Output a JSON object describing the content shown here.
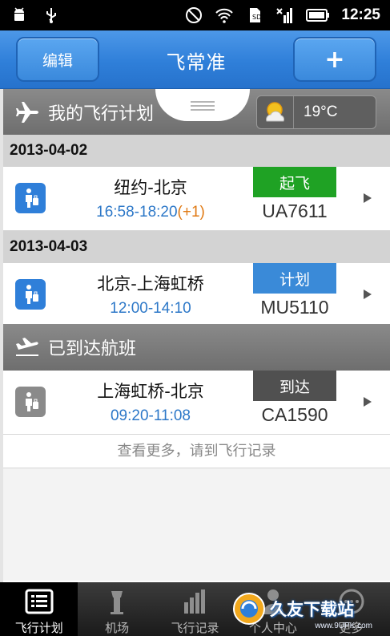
{
  "status_bar": {
    "time": "12:25",
    "icons": [
      "android-icon",
      "usb-icon",
      "no-signal-icon",
      "wifi-icon",
      "sd-card-icon",
      "signal-x-icon",
      "battery-icon"
    ]
  },
  "header": {
    "edit_label": "编辑",
    "title": "飞常准",
    "add_label": "+"
  },
  "my_plans": {
    "title": "我的飞行计划",
    "weather": {
      "icon": "sun-cloud-icon",
      "temp": "19°C"
    }
  },
  "plan_groups": [
    {
      "date": "2013-04-02",
      "flights": [
        {
          "route": "纽约-北京",
          "time": "16:58-18:20",
          "time_extra": "(+1)",
          "status": "起飞",
          "status_color": "#1fa224",
          "flight_no": "UA7611"
        }
      ]
    },
    {
      "date": "2013-04-03",
      "flights": [
        {
          "route": "北京-上海虹桥",
          "time": "12:00-14:10",
          "time_extra": "",
          "status": "计划",
          "status_color": "#3a8ad8",
          "flight_no": "MU5110"
        }
      ]
    }
  ],
  "arrived": {
    "title": "已到达航班",
    "flights": [
      {
        "route": "上海虹桥-北京",
        "time": "09:20-11:08",
        "status": "到达",
        "status_color": "#505050",
        "flight_no": "CA1590"
      }
    ],
    "more_text": "查看更多，请到飞行记录"
  },
  "tabs": [
    {
      "label": "飞行计划",
      "icon": "list-icon",
      "active": true
    },
    {
      "label": "机场",
      "icon": "tower-icon",
      "active": false
    },
    {
      "label": "飞行记录",
      "icon": "bar-chart-icon",
      "active": false
    },
    {
      "label": "个人中心",
      "icon": "person-icon",
      "active": false
    },
    {
      "label": "更多",
      "icon": "more-icon",
      "active": false
    }
  ],
  "watermark": {
    "text": "久友下载站",
    "url": "www.9UPK.com"
  }
}
